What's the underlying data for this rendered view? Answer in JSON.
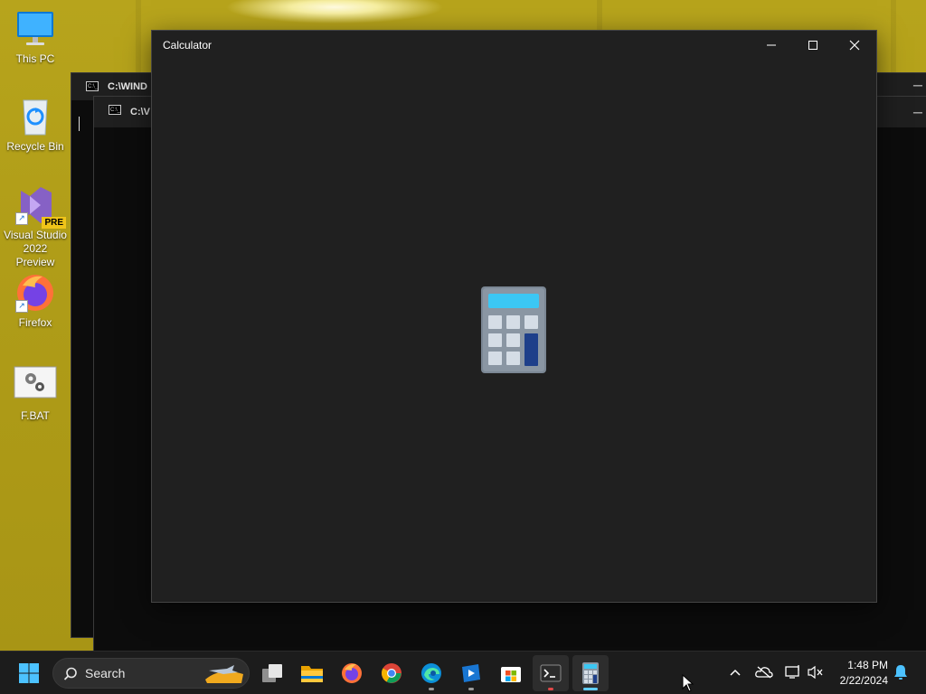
{
  "desktop": {
    "icons": [
      {
        "label": "This PC",
        "icon": "monitor-icon"
      },
      {
        "label": "Recycle Bin",
        "icon": "recycle-bin-icon"
      },
      {
        "label": "Visual Studio 2022 Preview",
        "icon": "visual-studio-icon",
        "badge": "PRE"
      },
      {
        "label": "Firefox",
        "icon": "firefox-icon"
      },
      {
        "label": "F.BAT",
        "icon": "batch-file-icon"
      }
    ]
  },
  "consoles": [
    {
      "title": "C:\\WIND",
      "icon_text": "C:\\_"
    },
    {
      "title": "C:\\V",
      "icon_text": "C:\\_"
    }
  ],
  "calculator": {
    "title": "Calculator",
    "minimize_glyph": "─",
    "maximize_glyph": "☐",
    "close_glyph": "✕"
  },
  "taskbar": {
    "search_label": "Search",
    "apps": [
      {
        "name": "task-view",
        "icon": "task-view-icon"
      },
      {
        "name": "file-explorer",
        "icon": "folder-icon"
      },
      {
        "name": "firefox",
        "icon": "firefox-icon"
      },
      {
        "name": "chrome",
        "icon": "chrome-icon"
      },
      {
        "name": "edge",
        "icon": "edge-icon"
      },
      {
        "name": "media-player",
        "icon": "media-player-icon"
      },
      {
        "name": "microsoft-store",
        "icon": "store-icon"
      },
      {
        "name": "terminal",
        "icon": "terminal-icon"
      },
      {
        "name": "calculator",
        "icon": "calculator-icon"
      }
    ],
    "tray": {
      "time": "1:48 PM",
      "date": "2/22/2024"
    }
  },
  "colors": {
    "wallpaper": "#b09d18",
    "window_bg": "#202020",
    "taskbar_bg": "#1c1c1c",
    "accent": "#60cdff"
  }
}
